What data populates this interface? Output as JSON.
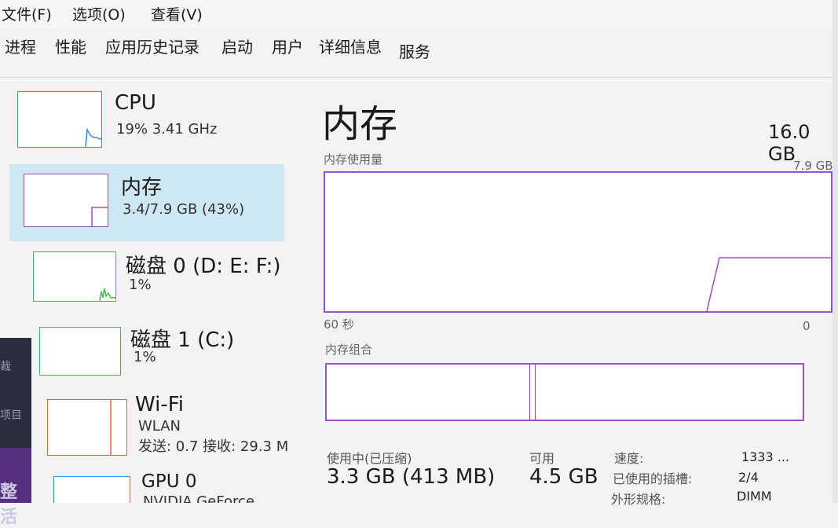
{
  "menu": {
    "file": "文件(F)",
    "options": "选项(O)",
    "view": "查看(V)"
  },
  "tabs": [
    "进程",
    "性能",
    "应用历史记录",
    "启动",
    "用户",
    "详细信息",
    "服务"
  ],
  "left_edge": {
    "text1": "裁",
    "text2": "项目",
    "text3": "整活"
  },
  "sidebar": [
    {
      "title": "CPU",
      "sub1": "19% 3.41 GHz",
      "sub2": ""
    },
    {
      "title": "内存",
      "sub1": "3.4/7.9 GB (43%)",
      "sub2": ""
    },
    {
      "title": "磁盘 0 (D: E: F:)",
      "sub1": "1%",
      "sub2": ""
    },
    {
      "title": "磁盘 1 (C:)",
      "sub1": "1%",
      "sub2": ""
    },
    {
      "title": "Wi-Fi",
      "sub1": "WLAN",
      "sub2": "发送: 0.7  接收: 29.3 M"
    },
    {
      "title": "GPU 0",
      "sub1": "NVIDIA GeForce",
      "sub2": ""
    }
  ],
  "main": {
    "title": "内存",
    "total": "16.0 GB",
    "usage_label": "内存使用量",
    "usage_max": "7.9 GB",
    "time_left": "60 秒",
    "time_right": "0",
    "composition_label": "内存组合",
    "stats": {
      "in_use_label": "使用中(已压缩)",
      "in_use_value": "3.3 GB (413 MB)",
      "available_label": "可用",
      "available_value": "4.5 GB",
      "speed_label": "速度:",
      "speed_value": "1333 ...",
      "slots_label": "已使用的插槽:",
      "slots_value": "2/4",
      "form_label": "外形规格:",
      "form_value": "DIMM"
    }
  },
  "colors": {
    "memory_accent": "#9b4dcf",
    "cpu_accent": "#3a8ad6",
    "disk_accent": "#4cb84c",
    "wifi_accent": "#d9643a",
    "selection_bg": "#cde8f3"
  }
}
